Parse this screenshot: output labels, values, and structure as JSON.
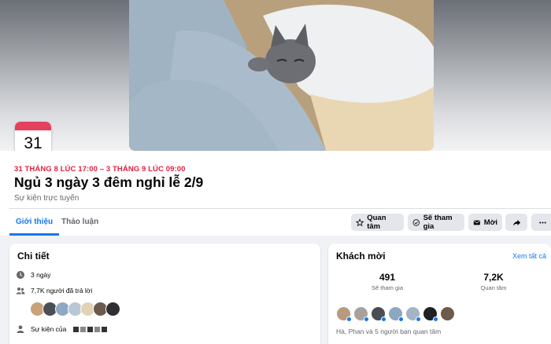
{
  "event": {
    "date_badge_day": "31",
    "time_range": "31 THÁNG 8 LÚC 17:00 – 3 THÁNG 9 LÚC 09:00",
    "title": "Ngủ 3 ngày 3 đêm nghỉ lễ 2/9",
    "type": "Sự kiện trực tuyến"
  },
  "tabs": [
    {
      "label": "Giới thiệu",
      "active": true
    },
    {
      "label": "Thảo luận",
      "active": false
    }
  ],
  "actions": {
    "interested": "Quan tâm",
    "going": "Sẽ tham gia",
    "invite": "Mời",
    "share_icon": "share-arrow-icon",
    "more_icon": "more-dots-icon"
  },
  "details": {
    "title": "Chi tiết",
    "duration": "3 ngày",
    "responses": "7,7K người đã trả lời",
    "host_prefix": "Sự kiện của"
  },
  "guests": {
    "title": "Khách mời",
    "see_all": "Xem tất cả",
    "going_count": "491",
    "going_label": "Sẽ tham gia",
    "interested_count": "7,2K",
    "interested_label": "Quan tâm",
    "friends_text": "Hà, Phan và 5 người bạn quan tâm"
  },
  "colors": {
    "accent": "#1877f2",
    "date_red": "#e41e3f"
  }
}
